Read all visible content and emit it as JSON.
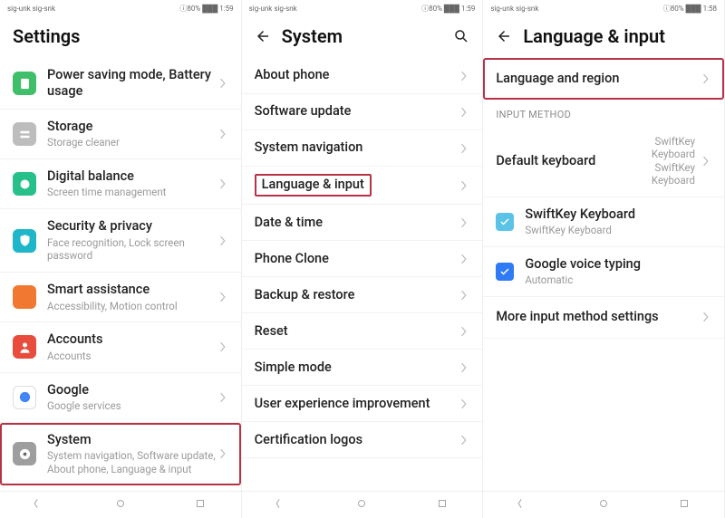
{
  "status": {
    "left": "sig-unk sig-snk",
    "right_signal": "⚪",
    "right": "ⓘ80% ███ 1:59",
    "right3": "ⓘ80% ███ 1:58"
  },
  "panel1": {
    "title": "Settings",
    "items": [
      {
        "title": "Power saving mode, Battery usage",
        "sub": "",
        "color": "#3fbf6a",
        "icon": "battery"
      },
      {
        "title": "Storage",
        "sub": "Storage cleaner",
        "color": "#bdbdbd",
        "icon": "storage"
      },
      {
        "title": "Digital balance",
        "sub": "Screen time management",
        "color": "#27c08a",
        "icon": "balance"
      },
      {
        "title": "Security & privacy",
        "sub": "Face recognition, Lock screen password",
        "color": "#1fb6c9",
        "icon": "shield"
      },
      {
        "title": "Smart assistance",
        "sub": "Accessibility, Motion control",
        "color": "#f07830",
        "icon": "assist"
      },
      {
        "title": "Accounts",
        "sub": "Accounts",
        "color": "#e74c3c",
        "icon": "user"
      },
      {
        "title": "Google",
        "sub": "Google services",
        "color": "#ffffff",
        "icon": "google"
      },
      {
        "title": "System",
        "sub": "System navigation, Software update, About phone, Language & input",
        "color": "#9e9e9e",
        "icon": "system",
        "highlight": true
      }
    ]
  },
  "panel2": {
    "title": "System",
    "items": [
      {
        "title": "About phone"
      },
      {
        "title": "Software update"
      },
      {
        "title": "System navigation"
      },
      {
        "title": "Language & input",
        "highlight": true
      },
      {
        "title": "Date & time"
      },
      {
        "title": "Phone Clone"
      },
      {
        "title": "Backup & restore"
      },
      {
        "title": "Reset"
      },
      {
        "title": "Simple mode"
      },
      {
        "title": "User experience improvement"
      },
      {
        "title": "Certification logos"
      }
    ]
  },
  "panel3": {
    "title": "Language & input",
    "top": {
      "title": "Language and region",
      "highlight": true
    },
    "section": "INPUT METHOD",
    "default_kb": {
      "title": "Default keyboard",
      "value": "SwiftKey Keyboard SwiftKey Keyboard"
    },
    "ime1": {
      "title": "SwiftKey Keyboard",
      "sub": "SwiftKey Keyboard",
      "color": "#5bc4e6"
    },
    "ime2": {
      "title": "Google voice typing",
      "sub": "Automatic",
      "color": "#2f7af5"
    },
    "more": {
      "title": "More input method settings"
    }
  }
}
